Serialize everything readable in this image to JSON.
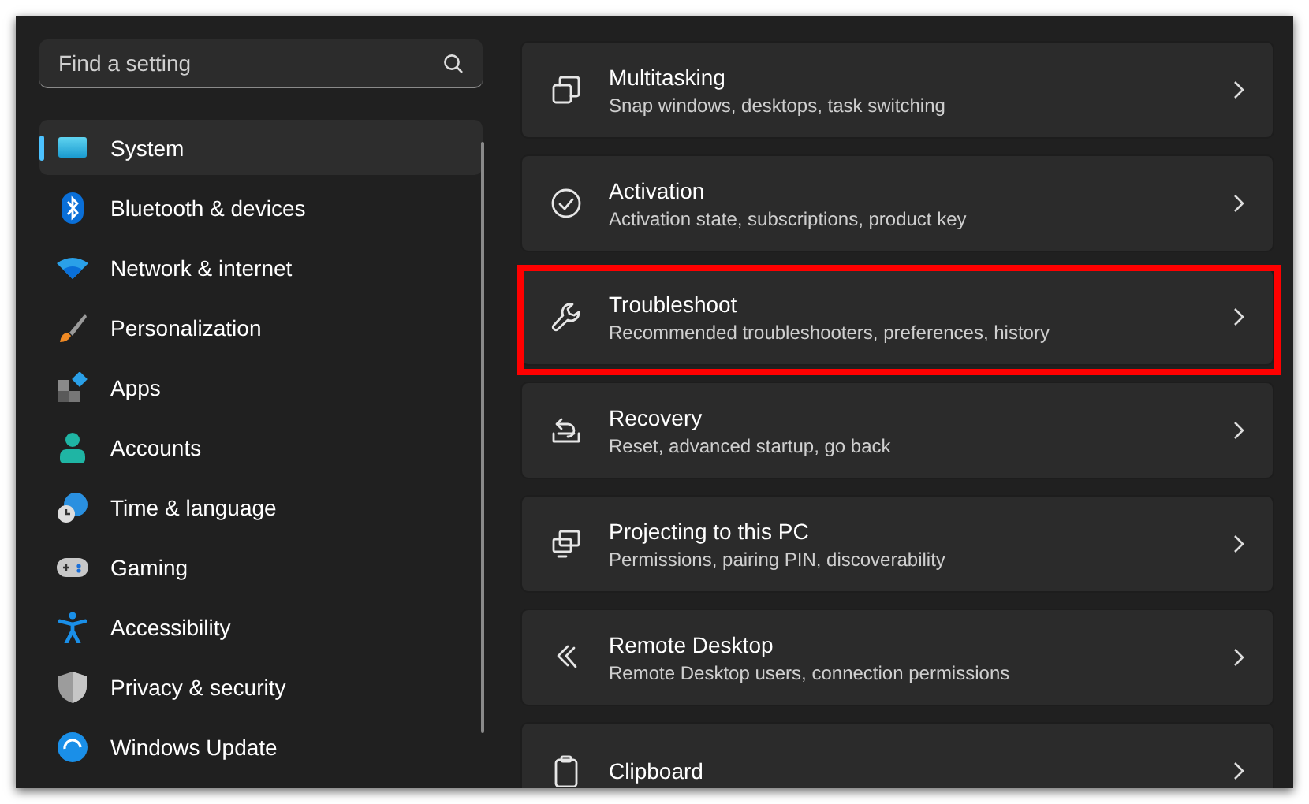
{
  "search": {
    "placeholder": "Find a setting"
  },
  "nav": [
    {
      "label": "System",
      "selected": true
    },
    {
      "label": "Bluetooth & devices",
      "selected": false
    },
    {
      "label": "Network & internet",
      "selected": false
    },
    {
      "label": "Personalization",
      "selected": false
    },
    {
      "label": "Apps",
      "selected": false
    },
    {
      "label": "Accounts",
      "selected": false
    },
    {
      "label": "Time & language",
      "selected": false
    },
    {
      "label": "Gaming",
      "selected": false
    },
    {
      "label": "Accessibility",
      "selected": false
    },
    {
      "label": "Privacy & security",
      "selected": false
    },
    {
      "label": "Windows Update",
      "selected": false
    }
  ],
  "cards": [
    {
      "title": "Multitasking",
      "subtitle": "Snap windows, desktops, task switching",
      "highlighted": false
    },
    {
      "title": "Activation",
      "subtitle": "Activation state, subscriptions, product key",
      "highlighted": false
    },
    {
      "title": "Troubleshoot",
      "subtitle": "Recommended troubleshooters, preferences, history",
      "highlighted": true
    },
    {
      "title": "Recovery",
      "subtitle": "Reset, advanced startup, go back",
      "highlighted": false
    },
    {
      "title": "Projecting to this PC",
      "subtitle": "Permissions, pairing PIN, discoverability",
      "highlighted": false
    },
    {
      "title": "Remote Desktop",
      "subtitle": "Remote Desktop users, connection permissions",
      "highlighted": false
    },
    {
      "title": "Clipboard",
      "highlighted": false
    }
  ]
}
